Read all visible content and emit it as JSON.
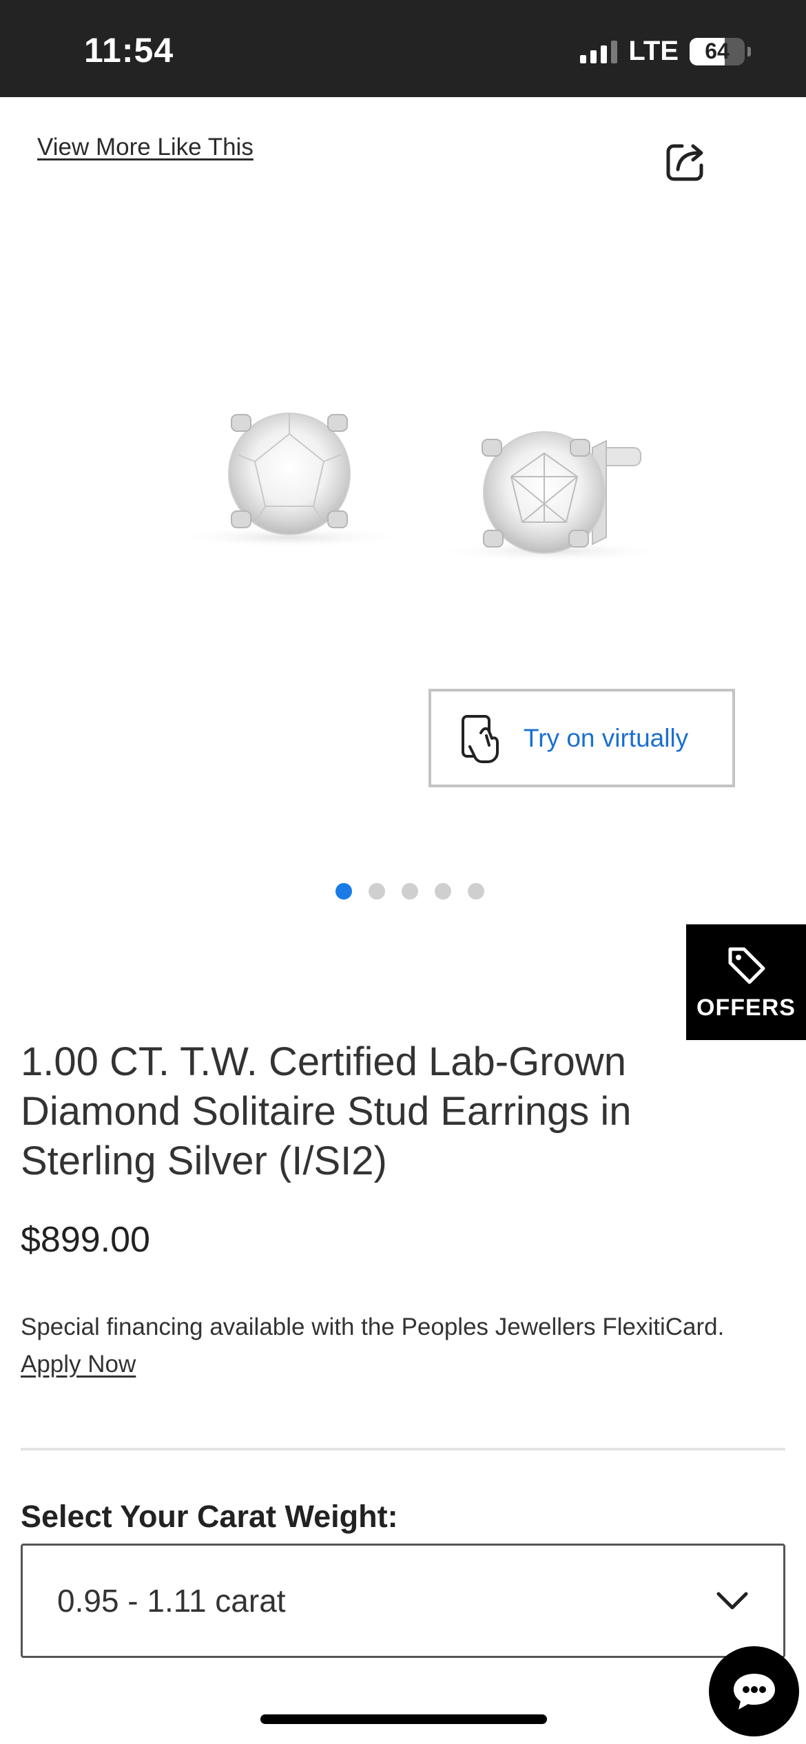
{
  "status_bar": {
    "time": "11:54",
    "network": "LTE",
    "battery_percent": "64",
    "battery_level": 0.64,
    "signal_bars": 3
  },
  "header": {
    "view_more_link": "View More Like This",
    "share_icon": "share-icon"
  },
  "gallery": {
    "image_alt_icon": "diamond-stud-earrings-image",
    "try_on_label": "Try on virtually",
    "try_on_icon": "hand-phone-icon",
    "dot_count": 5,
    "active_dot": 0
  },
  "offers": {
    "label": "OFFERS",
    "icon": "tag-icon"
  },
  "product": {
    "title": "1.00 CT. T.W. Certified Lab-Grown Diamond Solitaire Stud Earrings in Sterling Silver (I/SI2)",
    "price": "$899.00",
    "financing_text": "Special financing available with the Peoples Jewellers FlexitiCard.",
    "apply_now": "Apply Now"
  },
  "carat": {
    "label": "Select Your Carat Weight:",
    "selected": "0.95 - 1.11 carat",
    "icon": "chevron-down-icon"
  },
  "chat": {
    "icon": "chat-bubble-icon"
  },
  "colors": {
    "accent_blue": "#1a7be6",
    "link_blue": "#1a6fd1",
    "status_bar_bg": "#232323",
    "offers_bg": "#000000"
  }
}
